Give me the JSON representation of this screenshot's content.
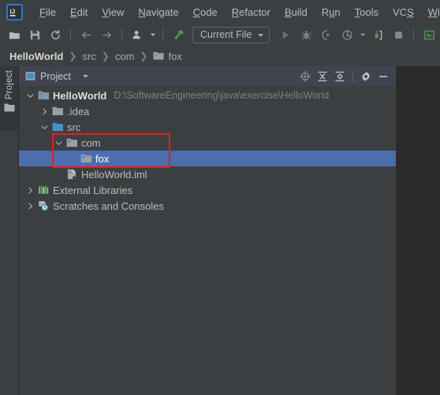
{
  "app": {
    "logo_label": "IJ",
    "logo_icon": "intellij-idea-logo"
  },
  "menubar": {
    "items": [
      {
        "label": "File",
        "mnemonic": "F"
      },
      {
        "label": "Edit",
        "mnemonic": "E"
      },
      {
        "label": "View",
        "mnemonic": "V"
      },
      {
        "label": "Navigate",
        "mnemonic": "N"
      },
      {
        "label": "Code",
        "mnemonic": "C"
      },
      {
        "label": "Refactor",
        "mnemonic": "R"
      },
      {
        "label": "Build",
        "mnemonic": "B"
      },
      {
        "label": "Run",
        "mnemonic": "u"
      },
      {
        "label": "Tools",
        "mnemonic": "T"
      },
      {
        "label": "VCS",
        "mnemonic": "S"
      },
      {
        "label": "Window",
        "mnemonic": "W"
      }
    ]
  },
  "toolbar": {
    "open_icon": "open-folder-icon",
    "save_icon": "save-icon",
    "sync_icon": "sync-refresh-icon",
    "back_icon": "arrow-left-icon",
    "forward_icon": "arrow-right-icon",
    "vcs_icon": "user-vcs-icon",
    "vcs_dropdown_icon": "chevron-down-icon",
    "build_icon": "build-hammer-icon",
    "run_config": {
      "label": "Current File",
      "dropdown_icon": "chevron-down-icon"
    },
    "run_icon": "run-play-icon",
    "debug_icon": "debug-bug-icon",
    "run_coverage_icon": "run-with-coverage-icon",
    "profile_icon": "profiler-icon",
    "profile_dropdown_icon": "chevron-down-icon",
    "attach_icon": "attach-debugger-icon",
    "stop_icon": "stop-square-icon",
    "search_everywhere_icon": "updates-monitor-icon",
    "no_entry_icon": "no-entry-circle-icon"
  },
  "breadcrumb": {
    "separator": "❯",
    "items": [
      {
        "label": "HelloWorld",
        "icon": null,
        "root": true
      },
      {
        "label": "src",
        "icon": null,
        "root": false
      },
      {
        "label": "com",
        "icon": null,
        "root": false
      },
      {
        "label": "fox",
        "icon": "folder-icon",
        "root": false
      }
    ]
  },
  "tool_stripe": {
    "project_tab": {
      "label": "Project",
      "icon": "folder-icon"
    }
  },
  "project_panel": {
    "title": "Project",
    "title_icon": "project-view-icon",
    "title_dropdown_icon": "chevron-down-icon",
    "actions": [
      {
        "name": "select-opened-file-icon",
        "tooltip": "Select Opened File"
      },
      {
        "name": "expand-all-icon",
        "tooltip": "Expand All"
      },
      {
        "name": "collapse-all-icon",
        "tooltip": "Collapse All"
      },
      {
        "name": "settings-gear-icon",
        "tooltip": "Settings"
      },
      {
        "name": "hide-minimize-icon",
        "tooltip": "Hide"
      }
    ]
  },
  "tree": {
    "rows": [
      {
        "label": "HelloWorld",
        "path_hint": "D:\\SoftwareEngineering\\java\\exercise\\HelloWorld",
        "indent": 0,
        "twisty": "expanded",
        "icon": "project-module-icon",
        "bold": true,
        "selected": false
      },
      {
        "label": ".idea",
        "path_hint": "",
        "indent": 1,
        "twisty": "collapsed",
        "icon": "folder-icon",
        "bold": false,
        "selected": false
      },
      {
        "label": "src",
        "path_hint": "",
        "indent": 1,
        "twisty": "expanded",
        "icon": "source-root-icon",
        "bold": false,
        "selected": false
      },
      {
        "label": "com",
        "path_hint": "",
        "indent": 2,
        "twisty": "expanded",
        "icon": "package-folder-icon",
        "bold": false,
        "selected": false
      },
      {
        "label": "fox",
        "path_hint": "",
        "indent": 3,
        "twisty": "none",
        "icon": "package-folder-icon",
        "bold": false,
        "selected": true
      },
      {
        "label": "HelloWorld.iml",
        "path_hint": "",
        "indent": 2,
        "twisty": "none",
        "icon": "module-file-icon",
        "bold": false,
        "selected": false
      },
      {
        "label": "External Libraries",
        "path_hint": "",
        "indent": 0,
        "twisty": "collapsed",
        "icon": "external-libraries-icon",
        "bold": false,
        "selected": false
      },
      {
        "label": "Scratches and Consoles",
        "path_hint": "",
        "indent": 0,
        "twisty": "collapsed",
        "icon": "scratches-icon",
        "bold": false,
        "selected": false
      }
    ]
  },
  "annotation": {
    "color": "#e81c1c",
    "shape": "rectangle",
    "target": "com-and-fox-package-rows"
  }
}
